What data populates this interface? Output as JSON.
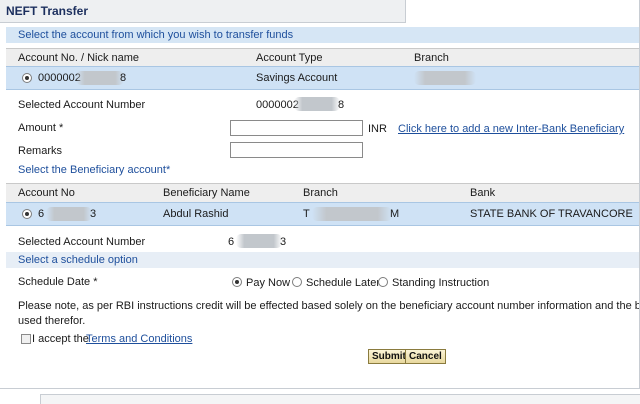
{
  "panel": {
    "title": "NEFT Transfer"
  },
  "source_section": {
    "heading": "Select the account from which you wish to transfer funds",
    "columns": [
      "Account No. / Nick name",
      "Account Type",
      "Branch"
    ],
    "row": {
      "account_no": "0000002",
      "account_suffix": "8",
      "account_type": "Savings Account",
      "branch": ""
    }
  },
  "selected_account": {
    "label": "Selected Account Number",
    "value": "0000002",
    "suffix": "8"
  },
  "amount": {
    "label": "Amount *",
    "value": "",
    "currency": "INR"
  },
  "add_beneficiary_link": "Click here to add a new Inter-Bank Beneficiary",
  "remarks": {
    "label": "Remarks",
    "value": ""
  },
  "beneficiary_section": {
    "heading": "Select the Beneficiary account*",
    "columns": [
      "Account No",
      "Beneficiary Name",
      "Branch",
      "Bank"
    ],
    "row": {
      "account_no": "6",
      "account_suffix": "3",
      "name": "Abdul Rashid",
      "branch": "T",
      "branch_suffix": "M",
      "bank": "STATE BANK OF TRAVANCORE"
    }
  },
  "beneficiary_selected": {
    "label": "Selected Account Number",
    "value": "6",
    "suffix": "3"
  },
  "schedule_section": {
    "heading": "Select a schedule option",
    "label": "Schedule Date *",
    "options": [
      "Pay Now",
      "Schedule Later",
      "Standing Instruction"
    ],
    "selected": "Pay Now"
  },
  "note": {
    "line1": "Please note, as per RBI instructions credit will be effected based solely on the beneficiary account number information and the benefi",
    "line2": "used therefor."
  },
  "terms": {
    "prefix": "I accept the ",
    "link": "Terms and Conditions",
    "checked": false
  },
  "buttons": {
    "submit": "Submit",
    "cancel": "Cancel"
  }
}
